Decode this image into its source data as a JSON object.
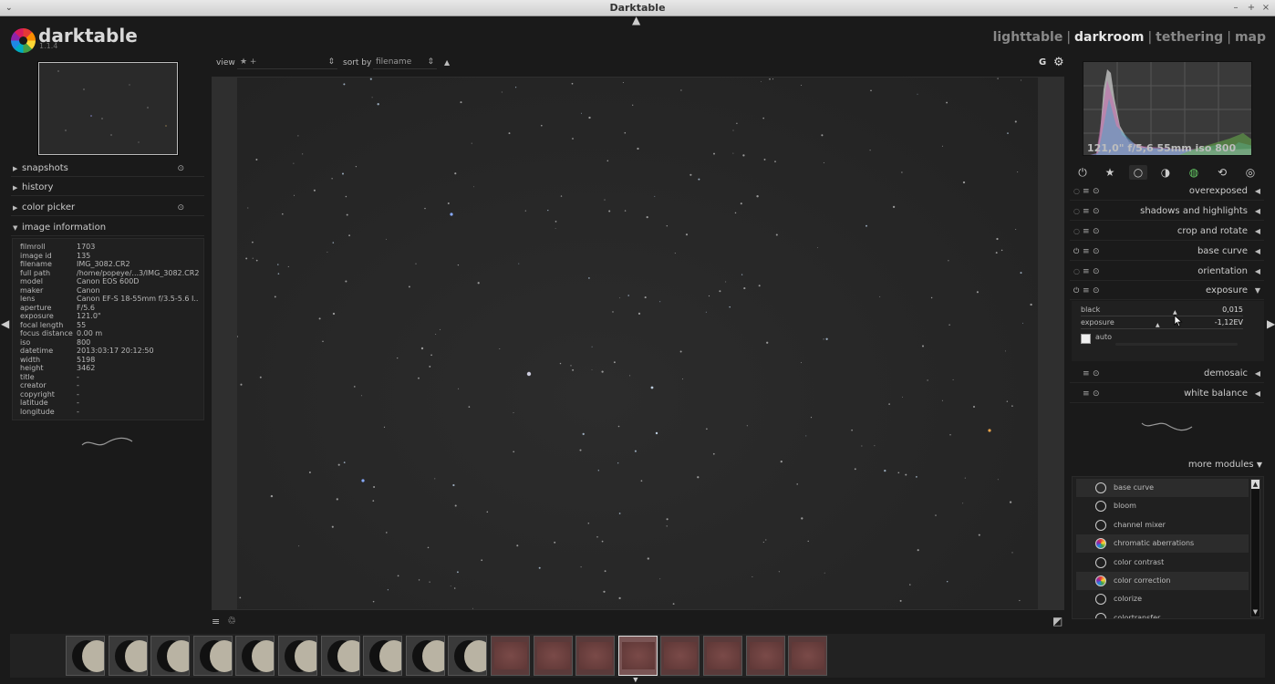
{
  "window": {
    "title": "Darktable",
    "menu_glyph": "⌄",
    "minimize": "–",
    "maximize": "+",
    "close": "×"
  },
  "logo": {
    "name": "darktable",
    "version": "1.1.4"
  },
  "views": [
    {
      "label": "lighttable",
      "active": false
    },
    {
      "label": "darkroom",
      "active": true
    },
    {
      "label": "tethering",
      "active": false
    },
    {
      "label": "map",
      "active": false
    }
  ],
  "view_separator": "|",
  "left_panel": {
    "sections": [
      {
        "label": "snapshots",
        "expanded": false,
        "has_reset": true
      },
      {
        "label": "history",
        "expanded": false,
        "has_reset": false
      },
      {
        "label": "color picker",
        "expanded": false,
        "has_reset": true
      },
      {
        "label": "image information",
        "expanded": true,
        "has_reset": false
      }
    ],
    "image_info": [
      {
        "key": "filmroll",
        "value": "1703"
      },
      {
        "key": "image id",
        "value": "135"
      },
      {
        "key": "filename",
        "value": "IMG_3082.CR2"
      },
      {
        "key": "full path",
        "value": "/home/popeye/...3/IMG_3082.CR2"
      },
      {
        "key": "model",
        "value": "Canon EOS 600D"
      },
      {
        "key": "maker",
        "value": "Canon"
      },
      {
        "key": "lens",
        "value": "Canon EF-S 18-55mm f/3.5-5.6 I..."
      },
      {
        "key": "aperture",
        "value": "F/5.6"
      },
      {
        "key": "exposure",
        "value": "121.0\""
      },
      {
        "key": "focal length",
        "value": "55"
      },
      {
        "key": "focus distance",
        "value": "0.00 m"
      },
      {
        "key": "iso",
        "value": "800"
      },
      {
        "key": "datetime",
        "value": "2013:03:17 20:12:50"
      },
      {
        "key": "width",
        "value": "5198"
      },
      {
        "key": "height",
        "value": "3462"
      },
      {
        "key": "title",
        "value": "-"
      },
      {
        "key": "creator",
        "value": "-"
      },
      {
        "key": "copyright",
        "value": "-"
      },
      {
        "key": "latitude",
        "value": "-"
      },
      {
        "key": "longitude",
        "value": "-"
      }
    ]
  },
  "toolbar": {
    "view_label": "view",
    "view_value": "★ +",
    "sort_label": "sort by",
    "sort_value": "filename",
    "sort_dir": "▲",
    "grouping": "G",
    "settings_glyph": "⚙"
  },
  "histogram": {
    "exif": "121,0\" f/5,6 55mm iso 800"
  },
  "module_groups": [
    "⏻",
    "★",
    "○",
    "◑",
    "◍",
    "⟲",
    "◎"
  ],
  "modules_top": [
    {
      "name": "overexposed",
      "enabled": false
    },
    {
      "name": "shadows and highlights",
      "enabled": false
    },
    {
      "name": "crop and rotate",
      "enabled": false
    },
    {
      "name": "base curve",
      "enabled": true
    },
    {
      "name": "orientation",
      "enabled": false
    },
    {
      "name": "exposure",
      "enabled": true,
      "expanded": true
    }
  ],
  "exposure_module": {
    "black_label": "black",
    "black_value": "0,015",
    "exposure_label": "exposure",
    "exposure_value": "-1,12EV",
    "auto_label": "auto"
  },
  "modules_bottom": [
    {
      "name": "demosaic"
    },
    {
      "name": "white balance"
    }
  ],
  "more_modules_label": "more modules",
  "more_modules": [
    {
      "name": "base curve",
      "highlight": true
    },
    {
      "name": "bloom",
      "highlight": false
    },
    {
      "name": "channel mixer",
      "highlight": false
    },
    {
      "name": "chromatic aberrations",
      "highlight": true
    },
    {
      "name": "color contrast",
      "highlight": false
    },
    {
      "name": "color correction",
      "highlight": true
    },
    {
      "name": "colorize",
      "highlight": false
    },
    {
      "name": "colortransfer",
      "highlight": false
    }
  ],
  "colors": {
    "accent": "#e6e6e6",
    "background": "#1a1a1a"
  }
}
